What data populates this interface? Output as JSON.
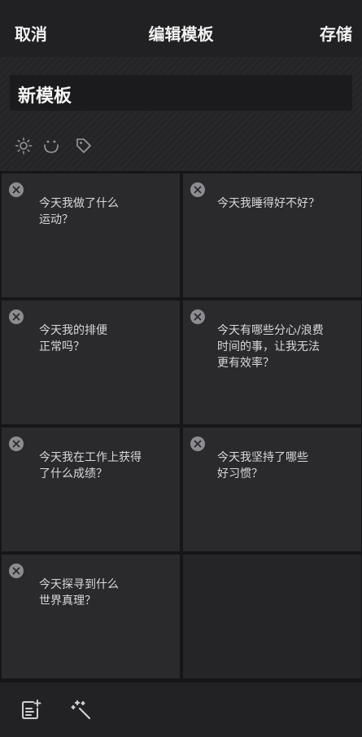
{
  "topbar": {
    "cancel_label": "取消",
    "title": "编辑模板",
    "save_label": "存储"
  },
  "template": {
    "name": "新模板",
    "icons": [
      "sun-icon",
      "smile-icon",
      "tag-icon"
    ]
  },
  "questions": [
    {
      "text": "今天我做了什么\n运动？"
    },
    {
      "text": "今天我睡得好不好？"
    },
    {
      "text": "今天我的排便\n正常吗？"
    },
    {
      "text": "今天有哪些分心/浪费\n时间的事，让我无法\n更有效率？"
    },
    {
      "text": "今天我在工作上获得\n了什么成绩？"
    },
    {
      "text": "今天我坚持了哪些\n好习惯？"
    },
    {
      "text": "今天探寻到什么\n世界真理？"
    }
  ],
  "bottombar": {
    "tools": [
      "add-note-icon",
      "magic-wand-icon"
    ]
  },
  "colors": {
    "background": "#1f1f22",
    "card": "#2a2a2d",
    "close_badge": "#8c8c91"
  }
}
